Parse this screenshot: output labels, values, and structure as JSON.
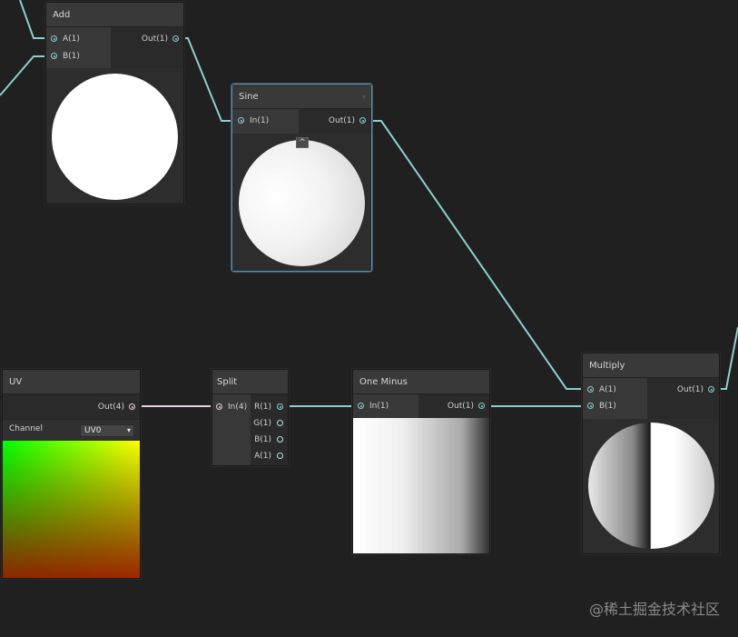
{
  "nodes": {
    "add": {
      "title": "Add",
      "in_a": "A(1)",
      "in_b": "B(1)",
      "out": "Out(1)"
    },
    "sine": {
      "title": "Sine",
      "in": "In(1)",
      "out": "Out(1)",
      "collapse_icon": "chevron-up-icon"
    },
    "uv": {
      "title": "UV",
      "out": "Out(4)",
      "channel_label": "Channel",
      "channel_value": "UV0"
    },
    "split": {
      "title": "Split",
      "in": "In(4)",
      "out_r": "R(1)",
      "out_g": "G(1)",
      "out_b": "B(1)",
      "out_a": "A(1)"
    },
    "one_minus": {
      "title": "One Minus",
      "in": "In(1)",
      "out": "Out(1)"
    },
    "multiply": {
      "title": "Multiply",
      "in_a": "A(1)",
      "in_b": "B(1)",
      "out": "Out(1)"
    }
  },
  "watermark": "@稀土掘金技术社区",
  "colors": {
    "background": "#202020",
    "wire": "#8ccfd0",
    "wire_uv": "#e6cfe0",
    "selection": "#5f8aa8"
  }
}
